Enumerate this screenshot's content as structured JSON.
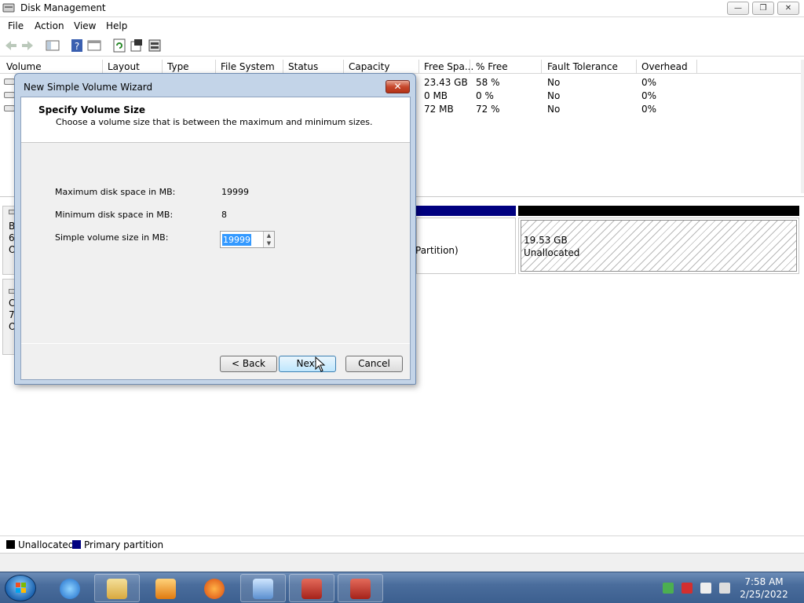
{
  "window": {
    "title": "Disk Management",
    "controls": {
      "minimize": "—",
      "maximize": "❐",
      "close": "✕"
    }
  },
  "menu": [
    "File",
    "Action",
    "View",
    "Help"
  ],
  "toolbar": {
    "icons": [
      "back-icon",
      "forward-icon",
      "show-hide-tree-icon",
      "help-icon",
      "console-icon",
      "refresh-icon",
      "properties-icon",
      "rescan-icon"
    ]
  },
  "volume_table": {
    "columns": [
      "Volume",
      "Layout",
      "Type",
      "File System",
      "Status",
      "Capacity",
      "Free Spa...",
      "% Free",
      "Fault Tolerance",
      "Overhead"
    ],
    "rows": [
      {
        "free_space": "23.43 GB",
        "pct_free": "58 %",
        "fault_tolerance": "No",
        "overhead": "0%"
      },
      {
        "free_space": "0 MB",
        "pct_free": "0 %",
        "fault_tolerance": "No",
        "overhead": "0%"
      },
      {
        "free_space": "72 MB",
        "pct_free": "72 %",
        "fault_tolerance": "No",
        "overhead": "0%"
      }
    ]
  },
  "graphical_view": {
    "disk0_label_lines": [
      "B",
      "6",
      "O"
    ],
    "disk1_label_lines": [
      "C",
      "7",
      "O"
    ],
    "primary_partition_text": "Partition)",
    "unallocated_size": "19.53 GB",
    "unallocated_label": "Unallocated",
    "colors": {
      "primary": "#000080",
      "unallocated": "#000000"
    }
  },
  "legend": {
    "items": [
      {
        "label": "Unallocated",
        "color": "#000000"
      },
      {
        "label": "Primary partition",
        "color": "#000080"
      }
    ]
  },
  "wizard": {
    "title": "New Simple Volume Wizard",
    "close_label": "✕",
    "heading": "Specify Volume Size",
    "subheading": "Choose a volume size that is between the maximum and minimum sizes.",
    "max_label": "Maximum disk space in MB:",
    "max_value": "19999",
    "min_label": "Minimum disk space in MB:",
    "min_value": "8",
    "size_label": "Simple volume size in MB:",
    "size_value": "19999",
    "back_label": "< Back",
    "next_label": "Next",
    "cancel_label": "Cancel"
  },
  "taskbar": {
    "apps": [
      "internet-explorer-icon",
      "windows-explorer-icon",
      "media-player-icon",
      "firefox-icon",
      "control-panel-icon",
      "toolbox-icon",
      "toolbox-icon"
    ],
    "clock_time": "7:58 AM",
    "clock_date": "2/25/2022"
  }
}
